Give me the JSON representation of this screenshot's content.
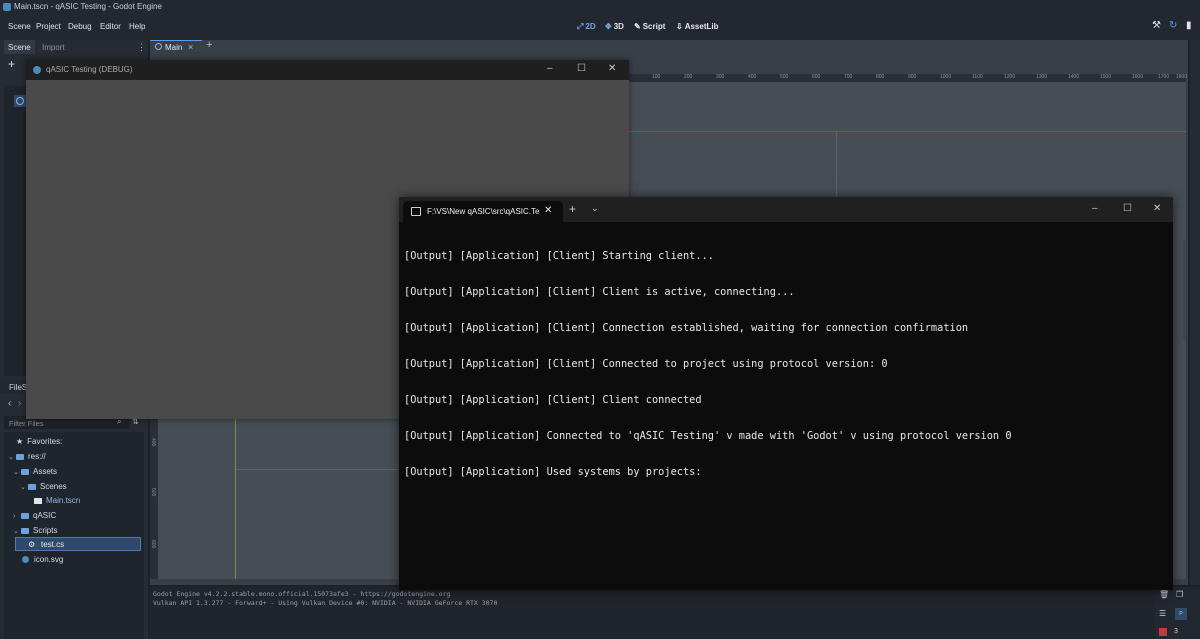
{
  "window_title": "Main.tscn - qASIC Testing - Godot Engine",
  "menu": [
    "Scene",
    "Project",
    "Debug",
    "Editor",
    "Help"
  ],
  "workspaces": {
    "two_d": "2D",
    "three_d": "3D",
    "script": "Script",
    "assetlib": "AssetLib"
  },
  "left_dock": {
    "tabs": [
      "Scene",
      "Import"
    ],
    "filesystem_tab": "FileS",
    "filter_placeholder": "Filter Files",
    "tree": {
      "favorites": "Favorites:",
      "root": "res://",
      "assets": "Assets",
      "scenes": "Scenes",
      "main_tscn": "Main.tscn",
      "qasic": "qASIC",
      "scripts": "Scripts",
      "test_cs": "test.cs",
      "icon_svg": "icon.svg"
    }
  },
  "editor_tab": "Main",
  "ruler": [
    "100",
    "200",
    "300",
    "400",
    "500",
    "600",
    "700",
    "800",
    "900",
    "1000",
    "1100",
    "1200",
    "1300",
    "1400",
    "1500",
    "1600",
    "1700",
    "1800"
  ],
  "ruler_left": [
    "400",
    "500",
    "600"
  ],
  "output_log": [
    "Godot Engine v4.2.2.stable.mono.official.15073afe3 - https://godotengine.org",
    "Vulkan API 1.3.277 - Forward+ - Using Vulkan Device #0: NVIDIA - NVIDIA GeForce RTX 3070"
  ],
  "right_badge": "3",
  "game_window": {
    "title": "qASIC Testing (DEBUG)"
  },
  "terminal": {
    "tab_title": "F:\\VS\\New qASIC\\src\\qASIC.Te",
    "lines": [
      "[Output] [Application] [Client] Starting client...",
      "[Output] [Application] [Client] Client is active, connecting...",
      "[Output] [Application] [Client] Connection established, waiting for connection confirmation",
      "[Output] [Application] [Client] Connected to project using protocol version: 0",
      "[Output] [Application] [Client] Client connected",
      "[Output] [Application] Connected to 'qASIC Testing' v made with 'Godot' v using protocol version 0",
      "[Output] [Application] Used systems by projects:"
    ]
  },
  "colors": {
    "godot_blue": "#478cbf",
    "selection": "#2f4a6b",
    "guide_red": "#a0404e",
    "guide_green": "#6c9a3a"
  }
}
